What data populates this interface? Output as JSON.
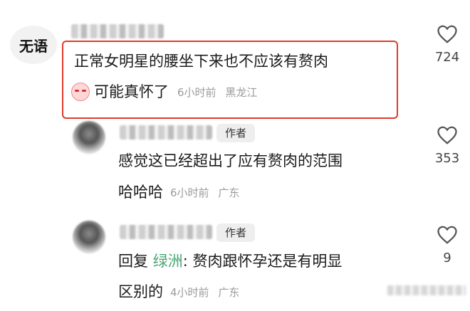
{
  "comments": [
    {
      "avatar_text": "无语",
      "text": "正常女明星的腰坐下来也不应该有赘肉",
      "text_line2": "可能真怀了",
      "time": "6小时前",
      "location": "黑龙江",
      "likes": "724"
    },
    {
      "badge": "作者",
      "text": "感觉这已经超出了应有赘肉的范围",
      "text_line2": "哈哈哈",
      "time": "6小时前",
      "location": "广东",
      "likes": "353"
    },
    {
      "badge": "作者",
      "reply_prefix": "回复",
      "reply_target": "绿洲",
      "text": ": 赘肉跟怀孕还是有明显",
      "text_line2": "区别的",
      "time": "4小时前",
      "location": "广东",
      "likes": "9"
    }
  ],
  "colors": {
    "highlight": "#e13a2c",
    "reply_target": "#4aa574",
    "meta": "#9b9b9b"
  }
}
